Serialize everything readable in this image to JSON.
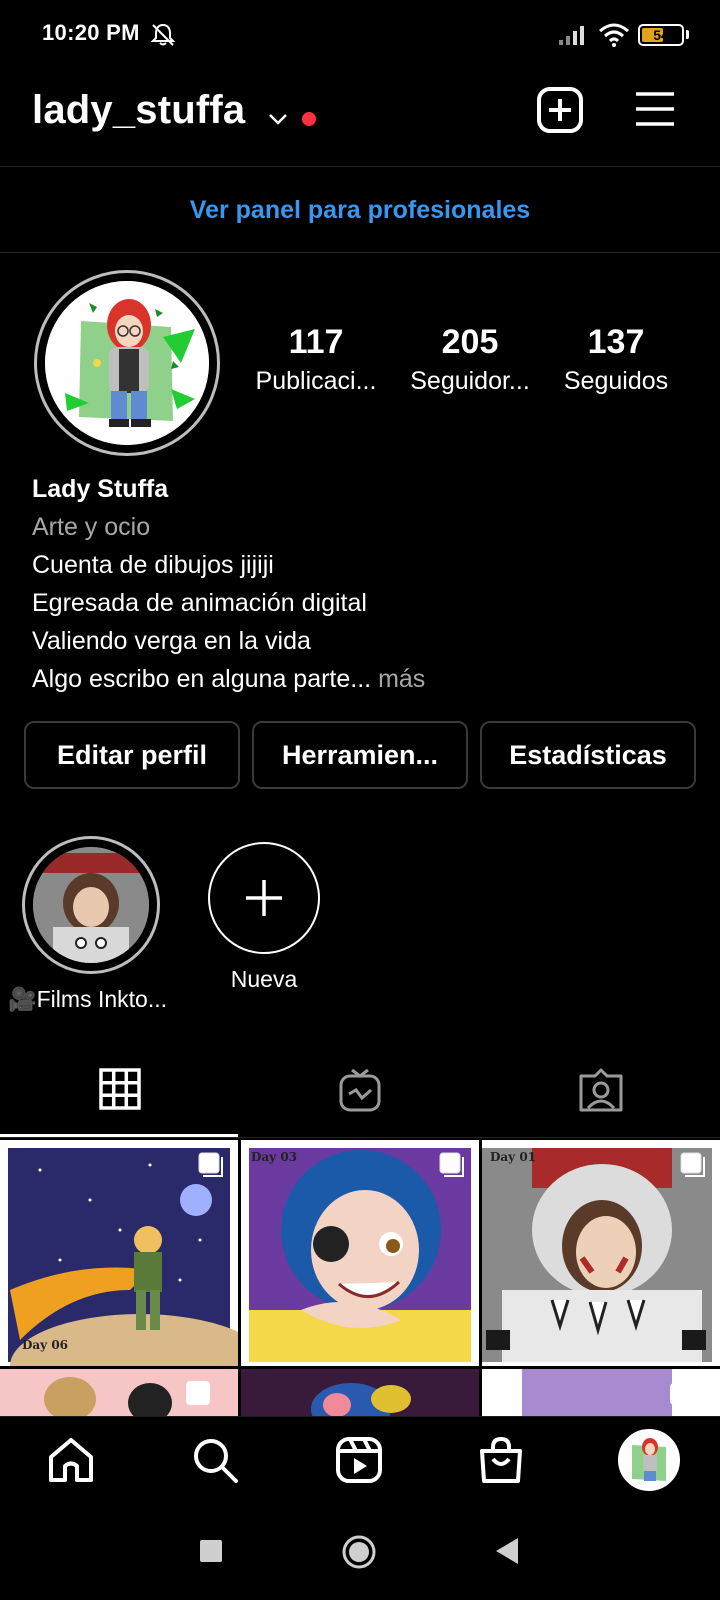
{
  "status_bar": {
    "time": "10:20 PM",
    "battery": "54",
    "battery_level": 0.54
  },
  "header": {
    "username": "lady_stuffa"
  },
  "professional_link": "Ver panel para profesionales",
  "stats": [
    {
      "number": "117",
      "label": "Publicaci..."
    },
    {
      "number": "205",
      "label": "Seguidor..."
    },
    {
      "number": "137",
      "label": "Seguidos"
    }
  ],
  "bio": {
    "name": "Lady Stuffa",
    "category": "Arte y ocio",
    "lines": [
      "Cuenta de dibujos jijiji",
      "Egresada de animación digital",
      "Valiendo verga en la vida"
    ],
    "last_line": "Algo escribo en alguna parte...",
    "more": " más"
  },
  "buttons": {
    "edit": "Editar perfil",
    "tools": "Herramien...",
    "insights": "Estadísticas"
  },
  "highlights": [
    {
      "label": "🎥Films Inkto..."
    },
    {
      "label": "Nueva"
    }
  ],
  "posts": [
    {
      "caption": "Day 06"
    },
    {
      "caption": "Day 03"
    },
    {
      "caption": "Day 01"
    }
  ],
  "colors": {
    "accent_link": "#3897f0",
    "notification_dot": "#ff3040",
    "battery": "#e0a51a"
  }
}
